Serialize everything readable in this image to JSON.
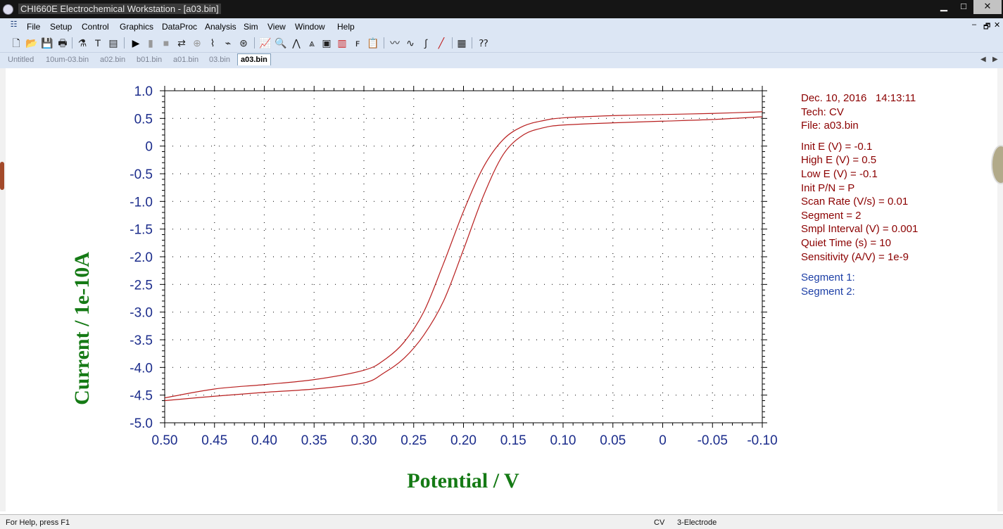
{
  "window": {
    "title": "CHI660E Electrochemical Workstation - [a03.bin]",
    "minimize": "▁",
    "maximize": "□",
    "close": "✕"
  },
  "menu": [
    "File",
    "Setup",
    "Control",
    "Graphics",
    "DataProc",
    "Analysis",
    "Sim",
    "View",
    "Window",
    "Help"
  ],
  "mdi_controls": {
    "minimize": "–",
    "restore": "🗗",
    "close": "✕"
  },
  "toolbar_icons": [
    "new-file-icon",
    "open-folder-icon",
    "save-icon",
    "print-icon",
    "technique-icon",
    "parameters-icon",
    "panel-icon",
    "run-icon",
    "pause-icon",
    "stop-icon",
    "reverse-scan-icon",
    "ir-comp-icon",
    "filter-icon",
    "cell-icon",
    "rotator-icon",
    "graph-icon",
    "zoom-icon",
    "peak-icon",
    "overlay-icon",
    "add-data-icon",
    "color-icon",
    "font-icon",
    "copy-icon",
    "smooth-icon",
    "derivative-icon",
    "integrate-icon",
    "manual-results-icon",
    "text-file-icon",
    "help-pointer-icon"
  ],
  "tabs": [
    "Untitled",
    "10um-03.bin",
    "a02.bin",
    "b01.bin",
    "a01.bin",
    "03.bin",
    "a03.bin"
  ],
  "active_tab": "a03.bin",
  "tab_scroll": {
    "left": "◀",
    "right": "▶"
  },
  "info": {
    "datetime": "Dec. 10, 2016   14:13:11",
    "tech": "Tech: CV",
    "file": "File: a03.bin",
    "params": [
      "Init E (V) = -0.1",
      "High E (V) = 0.5",
      "Low E (V) = -0.1",
      "Init P/N = P",
      "Scan Rate (V/s) = 0.01",
      "Segment = 2",
      "Smpl Interval (V) = 0.001",
      "Quiet Time (s) = 10",
      "Sensitivity (A/V) = 1e-9"
    ],
    "segments": [
      "Segment 1:",
      "Segment 2:"
    ]
  },
  "status": {
    "help": "For Help, press F1",
    "tech": "CV",
    "electrode": "3-Electrode"
  },
  "colors": {
    "axis_label": "#157a15",
    "tick_label": "#1c2d8c",
    "curve": "#b81f1f",
    "info_text": "#8b0000",
    "segment_text": "#1d3fa6"
  },
  "chart_data": {
    "type": "line",
    "xlabel": "Potential / V",
    "ylabel": "Current / 1e-10A",
    "xlim": [
      0.5,
      -0.1
    ],
    "ylim": [
      -5.0,
      1.0
    ],
    "x_reversed": true,
    "grid": true,
    "xticks": [
      "0.50",
      "0.45",
      "0.40",
      "0.35",
      "0.30",
      "0.25",
      "0.20",
      "0.15",
      "0.10",
      "0.05",
      "0",
      "-0.05",
      "-0.10"
    ],
    "yticks": [
      "1.0",
      "0.5",
      "0",
      "-0.5",
      "-1.0",
      "-1.5",
      "-2.0",
      "-2.5",
      "-3.0",
      "-3.5",
      "-4.0",
      "-4.5",
      "-5.0"
    ],
    "series": [
      {
        "x": [
          0.5,
          0.45,
          0.4,
          0.35,
          0.3,
          0.28,
          0.26,
          0.24,
          0.22,
          0.2,
          0.18,
          0.16,
          0.14,
          0.12,
          0.1,
          0.05,
          0.0,
          -0.05,
          -0.1
        ],
        "values": [
          -4.55,
          -4.39,
          -4.31,
          -4.22,
          -4.05,
          -3.87,
          -3.55,
          -3.0,
          -2.12,
          -1.18,
          -0.38,
          0.12,
          0.36,
          0.46,
          0.51,
          0.55,
          0.57,
          0.59,
          0.62
        ]
      },
      {
        "x": [
          0.5,
          0.45,
          0.4,
          0.35,
          0.3,
          0.28,
          0.26,
          0.24,
          0.22,
          0.2,
          0.18,
          0.16,
          0.14,
          0.12,
          0.1,
          0.05,
          0.0,
          -0.05,
          -0.1
        ],
        "values": [
          -4.6,
          -4.52,
          -4.45,
          -4.39,
          -4.28,
          -4.1,
          -3.84,
          -3.42,
          -2.8,
          -1.87,
          -0.9,
          -0.15,
          0.2,
          0.33,
          0.38,
          0.42,
          0.45,
          0.48,
          0.53
        ]
      }
    ]
  }
}
